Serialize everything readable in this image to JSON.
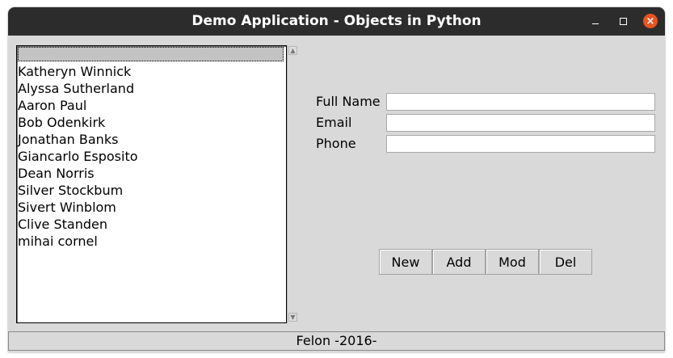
{
  "window": {
    "title": "Demo Application - Objects in Python",
    "controls": {
      "minimize": "minimize-icon",
      "maximize": "maximize-icon",
      "close": "close-icon"
    },
    "accent_color": "#e95420"
  },
  "listbox": {
    "selected_index": 0,
    "items": [
      "",
      "Katheryn Winnick",
      "Alyssa Sutherland",
      "Aaron Paul",
      "Bob Odenkirk",
      "Jonathan Banks",
      "Giancarlo Esposito",
      "Dean Norris",
      "Silver Stockbum",
      "Sivert Winblom",
      "Clive Standen",
      "mihai cornel"
    ]
  },
  "form": {
    "fullname_label": "Full Name",
    "email_label": "Email",
    "phone_label": "Phone",
    "fullname_value": "",
    "email_value": "",
    "phone_value": ""
  },
  "buttons": {
    "new": "New",
    "add": "Add",
    "mod": "Mod",
    "del": "Del"
  },
  "status": {
    "text": "Felon -2016-"
  }
}
